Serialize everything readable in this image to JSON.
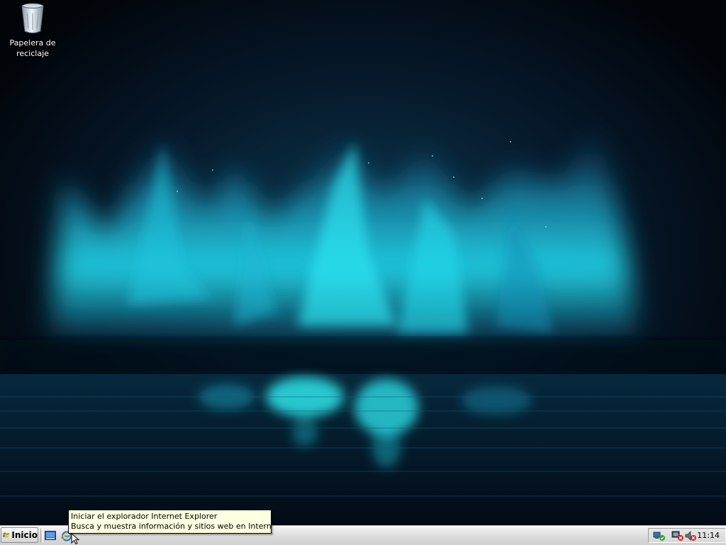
{
  "desktop": {
    "icons": [
      {
        "label": "Papelera de\nreciclaje",
        "icon": "recycle-bin-icon"
      }
    ]
  },
  "taskbar": {
    "start_label": "Inicio",
    "quick_launch": [
      {
        "icon": "show-desktop-icon"
      },
      {
        "icon": "internet-explorer-icon"
      }
    ],
    "tray": {
      "icons": [
        "network-connection-icon",
        "security-shield-icon",
        "volume-muted-icon"
      ],
      "clock": "11:14"
    }
  },
  "tooltip": {
    "line1": "Iniciar el explorador Internet Explorer",
    "line2": "Busca y muestra información y sitios web en Internet."
  },
  "colors": {
    "tooltip_bg": "#ffffe1",
    "taskbar_bg": "#dcdcdc",
    "wallpaper_glow": "#22e5f2"
  }
}
